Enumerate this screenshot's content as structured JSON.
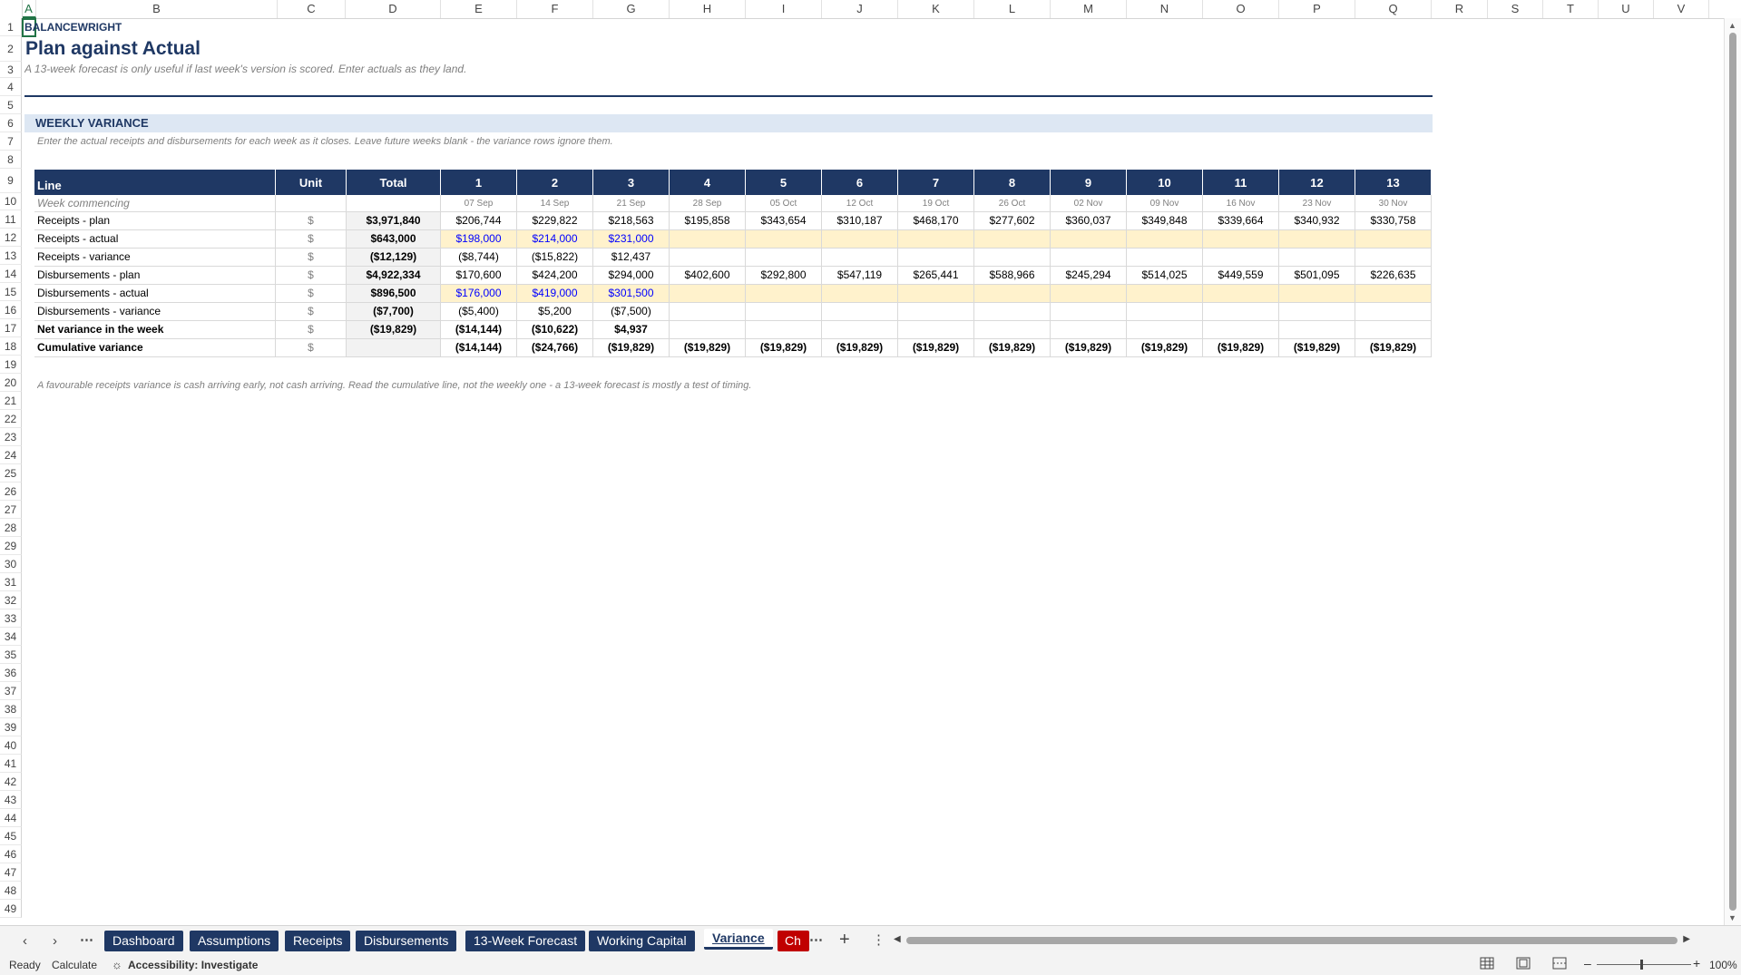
{
  "columns": [
    "A",
    "B",
    "C",
    "D",
    "E",
    "F",
    "G",
    "H",
    "I",
    "J",
    "K",
    "L",
    "M",
    "N",
    "O",
    "P",
    "Q",
    "R",
    "S",
    "T",
    "U",
    "V"
  ],
  "rows": [
    "1",
    "2",
    "3",
    "4",
    "5",
    "6",
    "7",
    "8",
    "9",
    "10",
    "11",
    "12",
    "13",
    "14",
    "15",
    "16",
    "17",
    "18",
    "19",
    "20",
    "21",
    "22",
    "23",
    "24",
    "25",
    "26",
    "27",
    "28",
    "29",
    "30",
    "31",
    "32",
    "33",
    "34",
    "35",
    "36",
    "37",
    "38",
    "39",
    "40",
    "41",
    "42",
    "43",
    "44",
    "45",
    "46",
    "47",
    "48",
    "49"
  ],
  "brand": "BALANCEWRIGHT",
  "title": "Plan against Actual",
  "subtitle": "A 13-week forecast is only useful if last week's version is scored. Enter actuals as they land.",
  "section_title": "WEEKLY VARIANCE",
  "instruction": "Enter the actual receipts and disbursements for each week as it closes. Leave future weeks blank - the variance rows ignore them.",
  "table": {
    "header": {
      "line": "Line",
      "unit": "Unit",
      "total": "Total",
      "weeks": [
        "1",
        "2",
        "3",
        "4",
        "5",
        "6",
        "7",
        "8",
        "9",
        "10",
        "11",
        "12",
        "13"
      ]
    },
    "week_row": {
      "label": "Week commencing",
      "dates": [
        "07 Sep",
        "14 Sep",
        "21 Sep",
        "28 Sep",
        "05 Oct",
        "12 Oct",
        "19 Oct",
        "26 Oct",
        "02 Nov",
        "09 Nov",
        "16 Nov",
        "23 Nov",
        "30 Nov"
      ]
    },
    "rows": [
      {
        "label": "Receipts - plan",
        "unit": "$",
        "total": "$3,971,840",
        "values": [
          "$206,744",
          "$229,822",
          "$218,563",
          "$195,858",
          "$343,654",
          "$310,187",
          "$468,170",
          "$277,602",
          "$360,037",
          "$349,848",
          "$339,664",
          "$340,932",
          "$330,758"
        ]
      },
      {
        "label": "Receipts - actual",
        "unit": "$",
        "total": "$643,000",
        "values": [
          "$198,000",
          "$214,000",
          "$231,000",
          "",
          "",
          "",
          "",
          "",
          "",
          "",
          "",
          "",
          ""
        ]
      },
      {
        "label": "Receipts - variance",
        "unit": "$",
        "total": "($12,129)",
        "values": [
          "($8,744)",
          "($15,822)",
          "$12,437",
          "",
          "",
          "",
          "",
          "",
          "",
          "",
          "",
          "",
          ""
        ]
      },
      {
        "label": "Disbursements - plan",
        "unit": "$",
        "total": "$4,922,334",
        "values": [
          "$170,600",
          "$424,200",
          "$294,000",
          "$402,600",
          "$292,800",
          "$547,119",
          "$265,441",
          "$588,966",
          "$245,294",
          "$514,025",
          "$449,559",
          "$501,095",
          "$226,635"
        ]
      },
      {
        "label": "Disbursements - actual",
        "unit": "$",
        "total": "$896,500",
        "values": [
          "$176,000",
          "$419,000",
          "$301,500",
          "",
          "",
          "",
          "",
          "",
          "",
          "",
          "",
          "",
          ""
        ]
      },
      {
        "label": "Disbursements - variance",
        "unit": "$",
        "total": "($7,700)",
        "values": [
          "($5,400)",
          "$5,200",
          "($7,500)",
          "",
          "",
          "",
          "",
          "",
          "",
          "",
          "",
          "",
          ""
        ]
      },
      {
        "label": "Net variance in the week",
        "unit": "$",
        "total": "($19,829)",
        "values": [
          "($14,144)",
          "($10,622)",
          "$4,937",
          "",
          "",
          "",
          "",
          "",
          "",
          "",
          "",
          "",
          ""
        ]
      },
      {
        "label": "Cumulative variance",
        "unit": "$",
        "total": "",
        "values": [
          "($14,144)",
          "($24,766)",
          "($19,829)",
          "($19,829)",
          "($19,829)",
          "($19,829)",
          "($19,829)",
          "($19,829)",
          "($19,829)",
          "($19,829)",
          "($19,829)",
          "($19,829)",
          "($19,829)"
        ]
      }
    ]
  },
  "footnote": "A favourable receipts variance is cash arriving early, not cash arriving. Read the cumulative line, not the weekly one - a 13-week forecast is mostly a test of timing.",
  "tabs": [
    "Dashboard",
    "Assumptions",
    "Receipts",
    "Disbursements",
    "13-Week Forecast",
    "Working Capital",
    "Variance",
    "Ch"
  ],
  "active_tab": "Variance",
  "status": {
    "ready": "Ready",
    "calculate": "Calculate",
    "accessibility": "Accessibility: Investigate",
    "zoom": "100%"
  },
  "colors": {
    "navy": "#1f3864",
    "input_fill": "#fff2cc",
    "input_text": "#0000ff",
    "section_fill": "#dde7f3",
    "excel_green": "#217346"
  },
  "icons": [
    "prev-sheet-icon",
    "next-sheet-icon",
    "more-sheets-icon",
    "add-sheet-icon",
    "normal-view-icon",
    "page-layout-icon",
    "page-break-icon",
    "accessibility-icon"
  ]
}
